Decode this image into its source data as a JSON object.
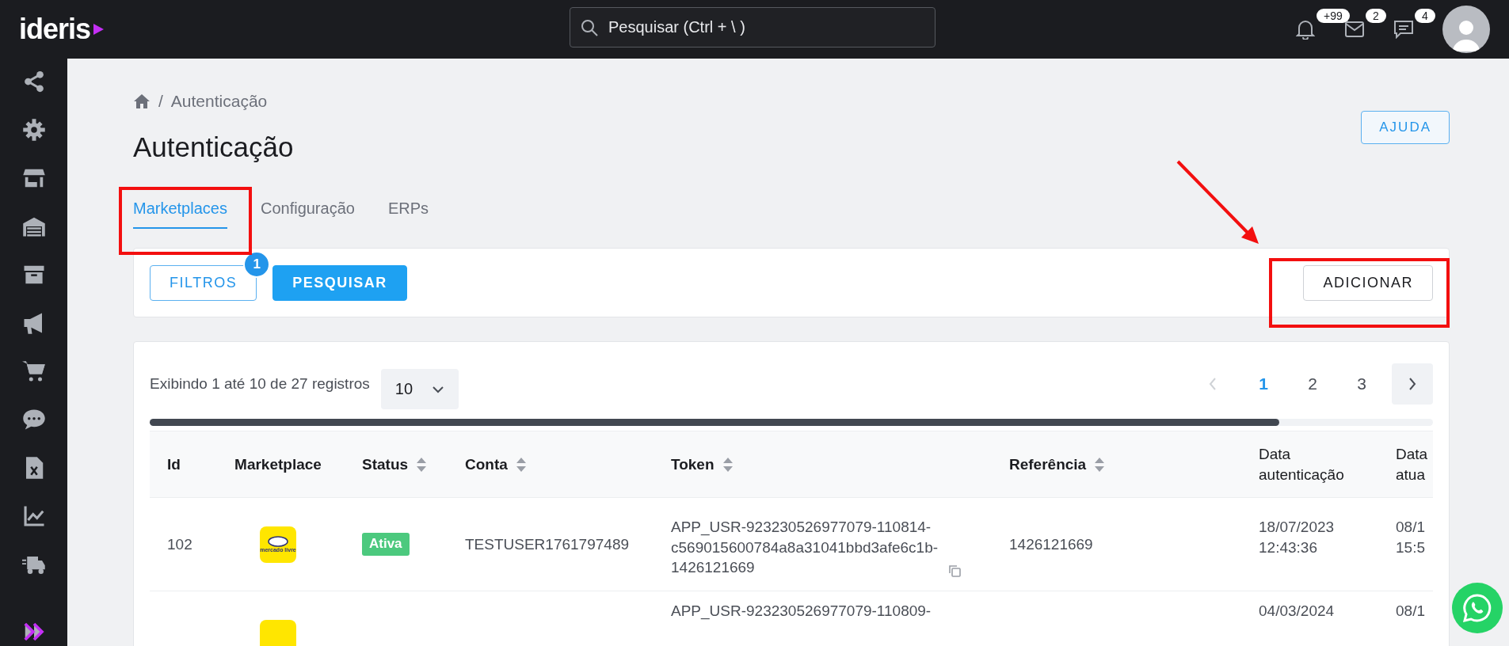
{
  "topbar": {
    "logo": "ideris",
    "search": {
      "placeholder": "Pesquisar (Ctrl + \\ )"
    },
    "notifications": [
      {
        "kind": "bell",
        "count": "+99"
      },
      {
        "kind": "mail",
        "count": "2"
      },
      {
        "kind": "chat",
        "count": "4"
      }
    ]
  },
  "sidebar": {
    "items": [
      {
        "kind": "share"
      },
      {
        "kind": "gear"
      },
      {
        "kind": "store"
      },
      {
        "kind": "warehouse"
      },
      {
        "kind": "box"
      },
      {
        "kind": "megaphone"
      },
      {
        "kind": "cart"
      },
      {
        "kind": "chat"
      },
      {
        "kind": "sheet"
      },
      {
        "kind": "chart"
      },
      {
        "kind": "truck"
      }
    ]
  },
  "breadcrumb": {
    "separator": "/",
    "current": "Autenticação"
  },
  "title": "Autenticação",
  "help_button": "AJUDA",
  "tabs": [
    {
      "label": "Marketplaces",
      "selected": true
    },
    {
      "label": "Configuração",
      "selected": false
    },
    {
      "label": "ERPs",
      "selected": false
    }
  ],
  "toolbar": {
    "filters_button": "FILTROS",
    "filters_badge": "1",
    "search_button": "PESQUISAR",
    "add_button": "ADICIONAR"
  },
  "table": {
    "info": "Exibindo 1 até 10 de 27 registros",
    "page_size": "10",
    "pages": [
      {
        "label": "1",
        "selected": true
      },
      {
        "label": "2",
        "selected": false
      },
      {
        "label": "3",
        "selected": false
      }
    ],
    "columns": [
      {
        "label": "Id",
        "sortable": false
      },
      {
        "label": "Marketplace",
        "sortable": false
      },
      {
        "label": "Status",
        "sortable": true
      },
      {
        "label": "Conta",
        "sortable": true
      },
      {
        "label": "Token",
        "sortable": true
      },
      {
        "label": "Referência",
        "sortable": true
      },
      {
        "label": "Data autenticação",
        "sortable": false
      },
      {
        "label": "Data atua"
      }
    ],
    "rows": [
      {
        "id": "102",
        "marketplace_logo": "mercado livre",
        "status": "Ativa",
        "account": "TESTUSER1761797489",
        "token": "APP_USR-923230526977079-110814-c569015600784a8a31041bbd3afe6c1b-1426121669",
        "reference": "1426121669",
        "auth_date": "18/07/2023 12:43:36",
        "update_date": "08/1 15:5"
      },
      {
        "token": "APP_USR-923230526977079-110809-",
        "auth_date": "04/03/2024",
        "update_date": "08/1"
      }
    ]
  },
  "annotations": [
    {
      "kind": "box"
    },
    {
      "kind": "box"
    },
    {
      "kind": "arrow"
    }
  ]
}
